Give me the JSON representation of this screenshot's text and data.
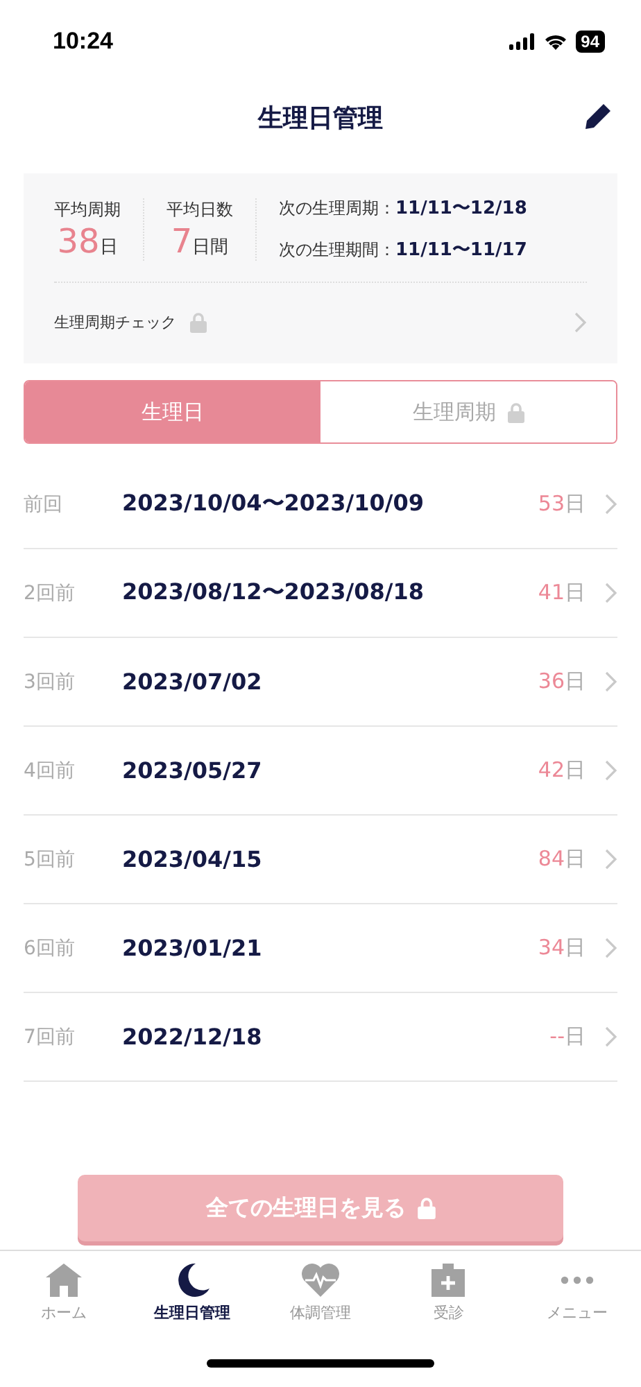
{
  "status_bar": {
    "time": "10:24",
    "battery": "94"
  },
  "header": {
    "title": "生理日管理"
  },
  "summary": {
    "stats": [
      {
        "label": "平均周期",
        "value": "38",
        "unit": "日"
      },
      {
        "label": "平均日数",
        "value": "7",
        "unit": "日間"
      }
    ],
    "next": [
      {
        "label": "次の生理周期：",
        "value": "11/11〜12/18"
      },
      {
        "label": "次の生理期間：",
        "value": "11/11〜11/17"
      }
    ],
    "check": {
      "label": "生理周期チェック",
      "locked": true
    }
  },
  "tabs": [
    {
      "label": "生理日",
      "selected": true,
      "locked": false
    },
    {
      "label": "生理周期",
      "selected": false,
      "locked": true
    }
  ],
  "records": [
    {
      "ago": "前回",
      "dates": "2023/10/04〜2023/10/09",
      "days": "53",
      "unit": "日"
    },
    {
      "ago": "2回前",
      "dates": "2023/08/12〜2023/08/18",
      "days": "41",
      "unit": "日"
    },
    {
      "ago": "3回前",
      "dates": "2023/07/02",
      "days": "36",
      "unit": "日"
    },
    {
      "ago": "4回前",
      "dates": "2023/05/27",
      "days": "42",
      "unit": "日"
    },
    {
      "ago": "5回前",
      "dates": "2023/04/15",
      "days": "84",
      "unit": "日"
    },
    {
      "ago": "6回前",
      "dates": "2023/01/21",
      "days": "34",
      "unit": "日"
    },
    {
      "ago": "7回前",
      "dates": "2022/12/18",
      "days": "--",
      "unit": "日"
    }
  ],
  "all_button": {
    "label": "全ての生理日を見る",
    "locked": true
  },
  "tab_bar": [
    {
      "kind": "home",
      "label": "ホーム",
      "selected": false
    },
    {
      "kind": "moon",
      "label": "生理日管理",
      "selected": true
    },
    {
      "kind": "heart",
      "label": "体調管理",
      "selected": false
    },
    {
      "kind": "clinic",
      "label": "受診",
      "selected": false
    },
    {
      "kind": "more",
      "label": "メニュー",
      "selected": false
    }
  ]
}
